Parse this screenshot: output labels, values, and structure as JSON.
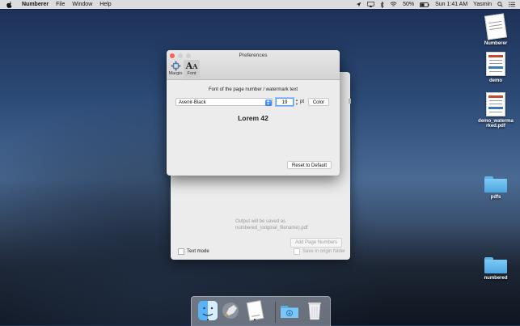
{
  "menubar": {
    "app_name": "Numberer",
    "menus": [
      "File",
      "Window",
      "Help"
    ],
    "battery": "50%",
    "clock": "Sun 1:41 AM",
    "user": "Yasmin"
  },
  "desktop_icons": [
    {
      "label": "Numberer",
      "kind": "document"
    },
    {
      "label": "demo",
      "kind": "document"
    },
    {
      "label": "demo_watermarked.pdf",
      "kind": "document"
    },
    {
      "label": "pdfs",
      "kind": "folder"
    },
    {
      "label": "numbered",
      "kind": "folder"
    }
  ],
  "back_window": {
    "output_line1": "Output will be saved as",
    "output_line2": "numbered_(original_filename).pdf",
    "add_button": "Add Page Numbers",
    "save_origin": "Save in origin folder",
    "text_mode": "Text mode"
  },
  "prefs": {
    "title": "Preferences",
    "toolbar": [
      {
        "label": "Margin",
        "icon": "margin-arrows-icon"
      },
      {
        "label": "Font",
        "icon": "font-aa-icon"
      }
    ],
    "subtitle": "Font of the page number / watermark text",
    "font_name": "Avenir-Black",
    "font_size": "19",
    "unit": "pt",
    "color_button": "Color",
    "preview": "Lorem 42",
    "reset_button": "Reset to Default"
  },
  "dock": [
    "Finder",
    "Launchpad",
    "Numberer",
    "Downloads",
    "Trash"
  ],
  "colors": {
    "close": "#fc605c",
    "minimize": "#fdbc40",
    "zoom": "#34c84a",
    "accent": "#2e7de9"
  }
}
